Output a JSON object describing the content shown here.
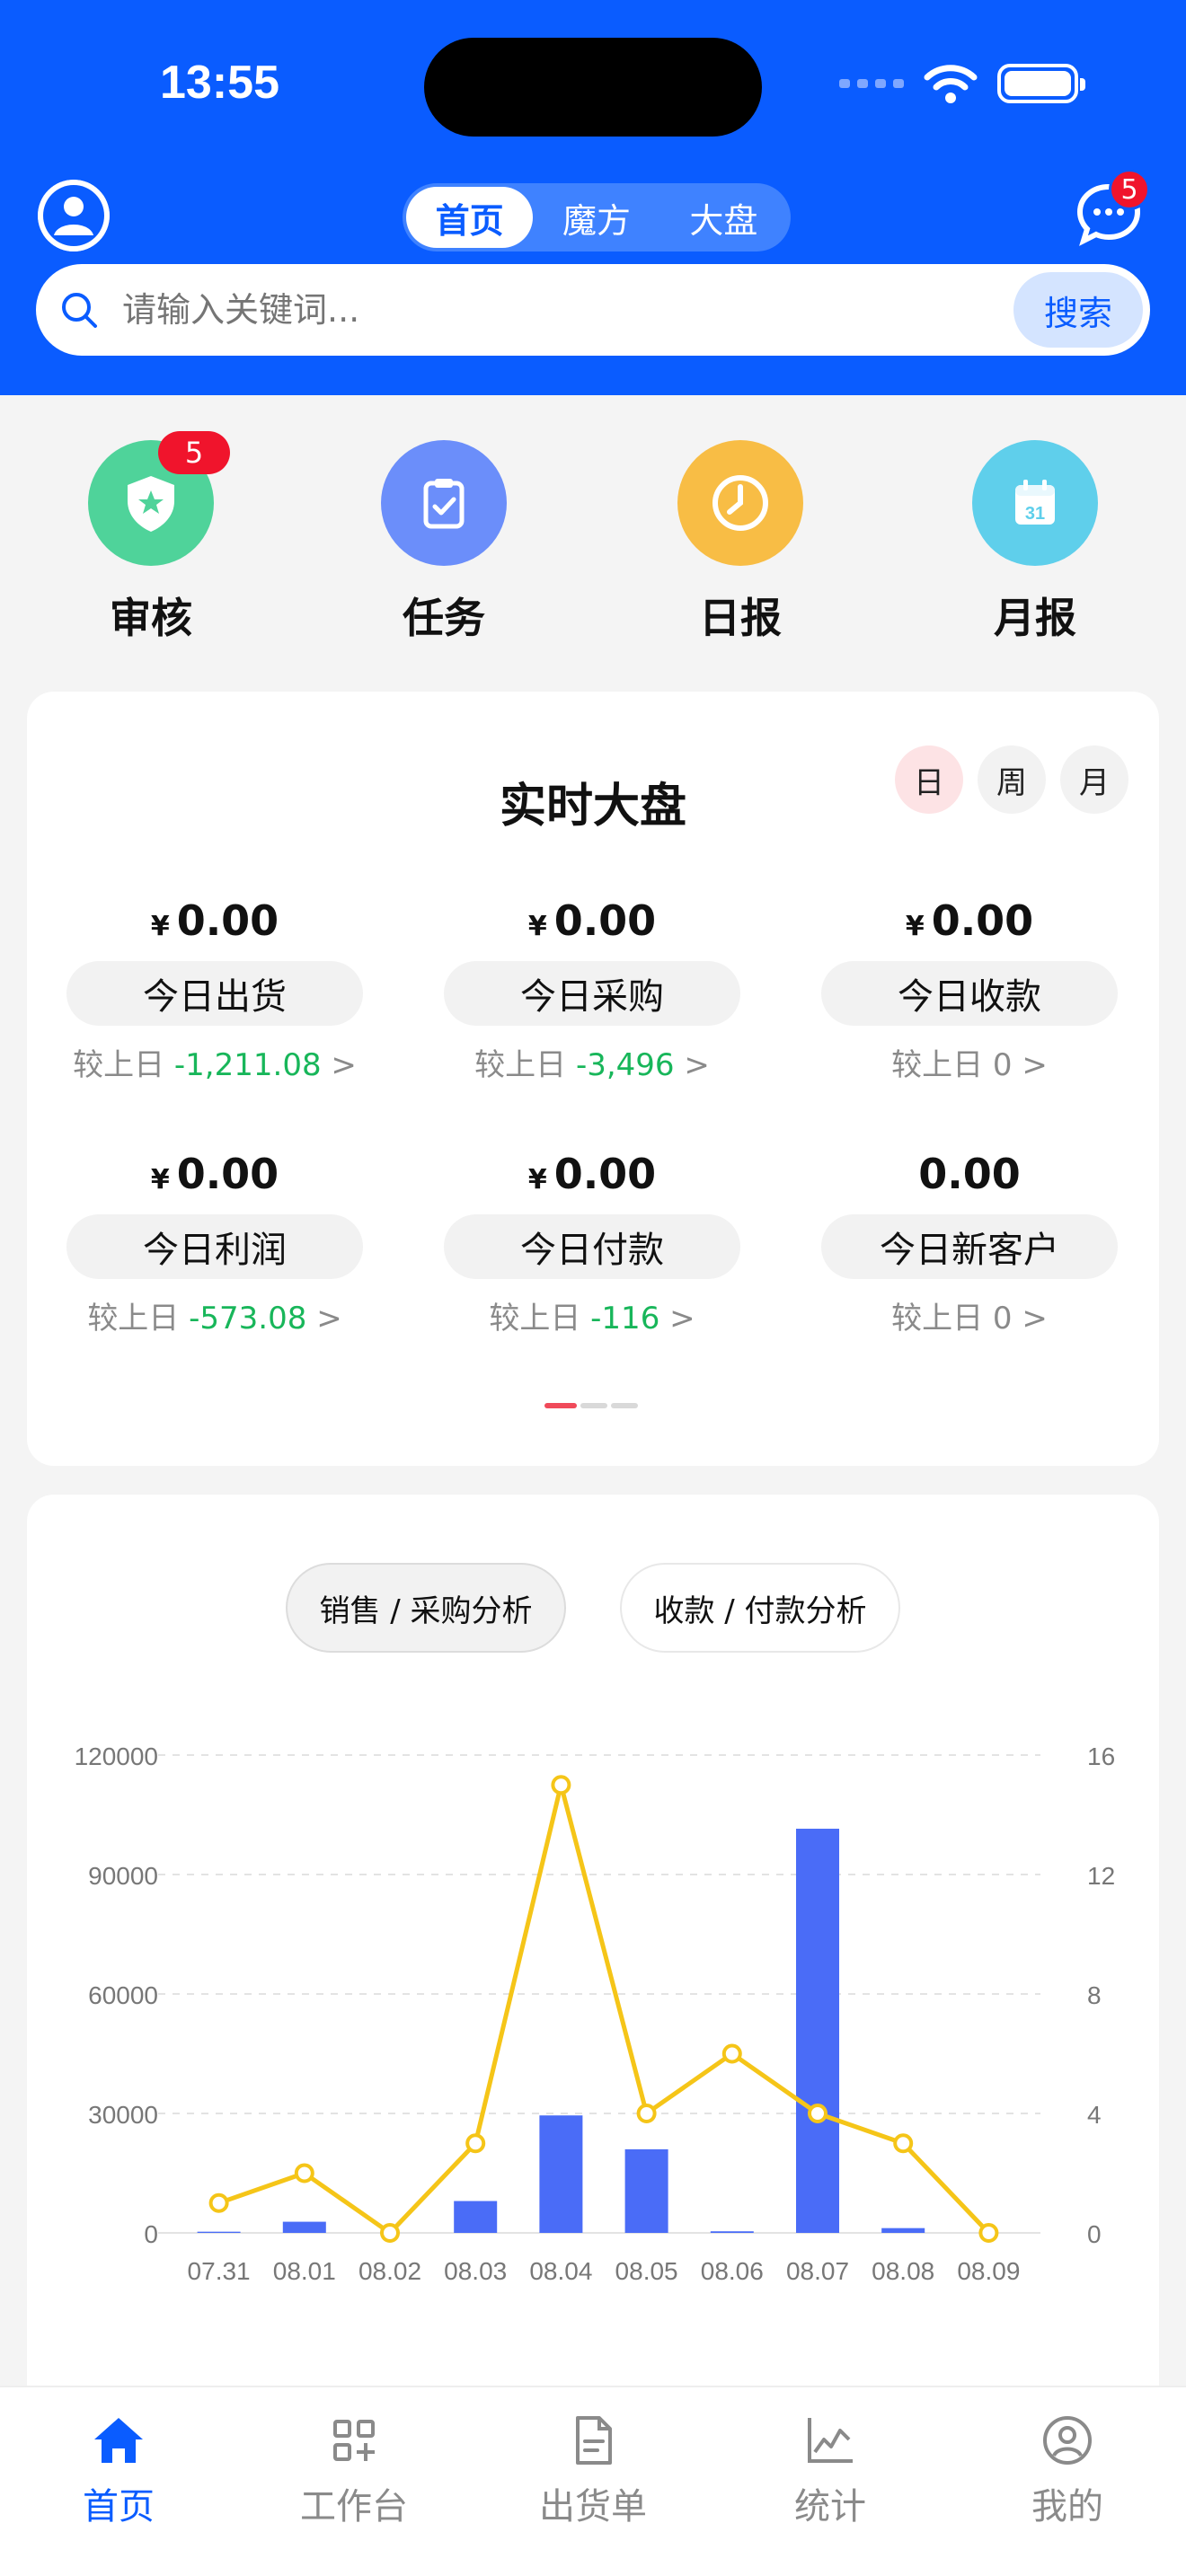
{
  "status_bar": {
    "time": "13:55"
  },
  "header": {
    "tabs": [
      {
        "label": "首页",
        "active": true
      },
      {
        "label": "魔方",
        "active": false
      },
      {
        "label": "大盘",
        "active": false
      }
    ],
    "message_badge": "5",
    "search": {
      "placeholder": "请输入关键词...",
      "button": "搜索"
    }
  },
  "quick_actions": [
    {
      "label": "审核",
      "icon": "shield-star-icon",
      "color": "#4fd39a",
      "badge": "5"
    },
    {
      "label": "任务",
      "icon": "clipboard-check-icon",
      "color": "#6b8efa"
    },
    {
      "label": "日报",
      "icon": "clock-icon",
      "color": "#f8bd45"
    },
    {
      "label": "月报",
      "icon": "calendar-icon",
      "color": "#5fcfeb"
    }
  ],
  "dashboard": {
    "title": "实时大盘",
    "periods": [
      {
        "label": "日",
        "active": true
      },
      {
        "label": "周",
        "active": false
      },
      {
        "label": "月",
        "active": false
      }
    ],
    "currency": "¥",
    "compare_prefix": "较上日",
    "metrics": [
      {
        "value": "0.00",
        "currency": "¥",
        "label": "今日出货",
        "delta": "-1,211.08",
        "arrow": ">"
      },
      {
        "value": "0.00",
        "currency": "¥",
        "label": "今日采购",
        "delta": "-3,496",
        "arrow": ">"
      },
      {
        "value": "0.00",
        "currency": "¥",
        "label": "今日收款",
        "delta": "0",
        "arrow": ">"
      },
      {
        "value": "0.00",
        "currency": "¥",
        "label": "今日利润",
        "delta": "-573.08",
        "arrow": ">"
      },
      {
        "value": "0.00",
        "currency": "¥",
        "label": "今日付款",
        "delta": "-116",
        "arrow": ">"
      },
      {
        "value": "0.00",
        "currency": "",
        "label": "今日新客户",
        "delta": "0",
        "arrow": ">"
      }
    ]
  },
  "analysis": {
    "tabs": [
      {
        "label": "销售 / 采购分析",
        "active": true
      },
      {
        "label": "收款 / 付款分析",
        "active": false
      }
    ]
  },
  "chart_data": {
    "type": "bar",
    "categories": [
      "07.31",
      "08.01",
      "08.02",
      "08.03",
      "08.04",
      "08.05",
      "08.06",
      "08.07",
      "08.08",
      "08.09"
    ],
    "series": [
      {
        "type": "bar",
        "axis": "left",
        "color": "#4a6cf7",
        "values": [
          300,
          2800,
          0,
          8000,
          29500,
          21000,
          400,
          101500,
          1200,
          0
        ]
      },
      {
        "type": "line",
        "axis": "right",
        "color": "#f5c518",
        "values": [
          1,
          2,
          0,
          3,
          15,
          4,
          6,
          4,
          3,
          0
        ]
      }
    ],
    "y_left": {
      "min": 0,
      "max": 120000,
      "ticks": [
        "0",
        "30000",
        "60000",
        "90000",
        "120000"
      ]
    },
    "y_right": {
      "min": 0,
      "max": 16,
      "ticks": [
        "0",
        "4",
        "8",
        "12",
        "16"
      ]
    },
    "grid": true
  },
  "tabbar": [
    {
      "label": "首页",
      "icon": "home-icon",
      "active": true
    },
    {
      "label": "工作台",
      "icon": "apps-icon",
      "active": false
    },
    {
      "label": "出货单",
      "icon": "document-icon",
      "active": false
    },
    {
      "label": "统计",
      "icon": "chart-icon",
      "active": false
    },
    {
      "label": "我的",
      "icon": "user-circle-icon",
      "active": false
    }
  ]
}
